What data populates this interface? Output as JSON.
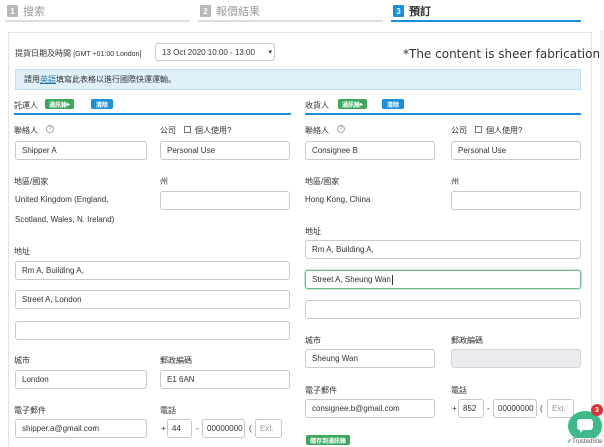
{
  "steps": [
    {
      "num": "1",
      "label": "搜索"
    },
    {
      "num": "2",
      "label": "報價結果"
    },
    {
      "num": "3",
      "label": "預訂"
    }
  ],
  "pickup": {
    "label": "提貨日期及時間",
    "timezone": "[GMT +01:00 London]",
    "selected": "13 Oct 2020 10:00 - 13:00"
  },
  "disclaimer": "*The content is sheer fabrication",
  "info": {
    "prefix": "請用",
    "link": "英語",
    "suffix": "填寫此表格以進行國際快運運輸。"
  },
  "sender": {
    "title": "託運人",
    "address_book_label": "通訊錄",
    "clear_label": "清除",
    "contact_label": "聯絡人",
    "contact_value": "Shipper A",
    "company_label": "公司",
    "personal_use_label": "個人使用?",
    "company_value": "Personal Use",
    "region_label": "地區/國家",
    "region_line1": "United Kingdom (England,",
    "region_line2": "Scotland, Wales, N. Ireland)",
    "state_label": "州",
    "state_value": "",
    "address_label": "地址",
    "address1": "Rm A, Building A,",
    "address2": "Street A,  London",
    "address3": "",
    "city_label": "城市",
    "city_value": "London",
    "postal_label": "郵政編碼",
    "postal_value": "E1 6AN",
    "email_label": "電子郵件",
    "email_value": "shipper.a@gmail.com",
    "phone_label": "電話",
    "phone_prefix": "+",
    "phone_code": "44",
    "phone_dash": "-",
    "phone_number": "00000000",
    "phone_paren": "(",
    "phone_ext_placeholder": "Ext."
  },
  "receiver": {
    "title": "收貨人",
    "address_book_label": "通訊錄",
    "clear_label": "清除",
    "contact_label": "聯絡人",
    "contact_value": "Consignee B",
    "company_label": "公司",
    "personal_use_label": "個人使用?",
    "company_value": "Personal Use",
    "region_label": "地區/國家",
    "region_value": "Hong Kong, China",
    "state_label": "州",
    "state_value": "",
    "address_label": "地址",
    "address1": "Rm A, Building A,",
    "address2": "Street A, Sheung Wan",
    "address3": "",
    "city_label": "城市",
    "city_value": "Sheung Wan",
    "postal_label": "郵政編碼",
    "postal_value": "",
    "email_label": "電子郵件",
    "email_value": "consignee.b@gmail.com",
    "phone_label": "電話",
    "phone_prefix": "+",
    "phone_code": "852",
    "phone_dash": "-",
    "phone_number": "00000000",
    "phone_paren": "(",
    "phone_ext_placeholder": "Ext.",
    "save_label": "儲存到通訊錄"
  },
  "chat": {
    "badge": "3"
  },
  "trusted": "TrustedSite",
  "colors": {
    "accent": "#1d8fd9",
    "green": "#3ba85c",
    "chat": "#3db98a"
  }
}
